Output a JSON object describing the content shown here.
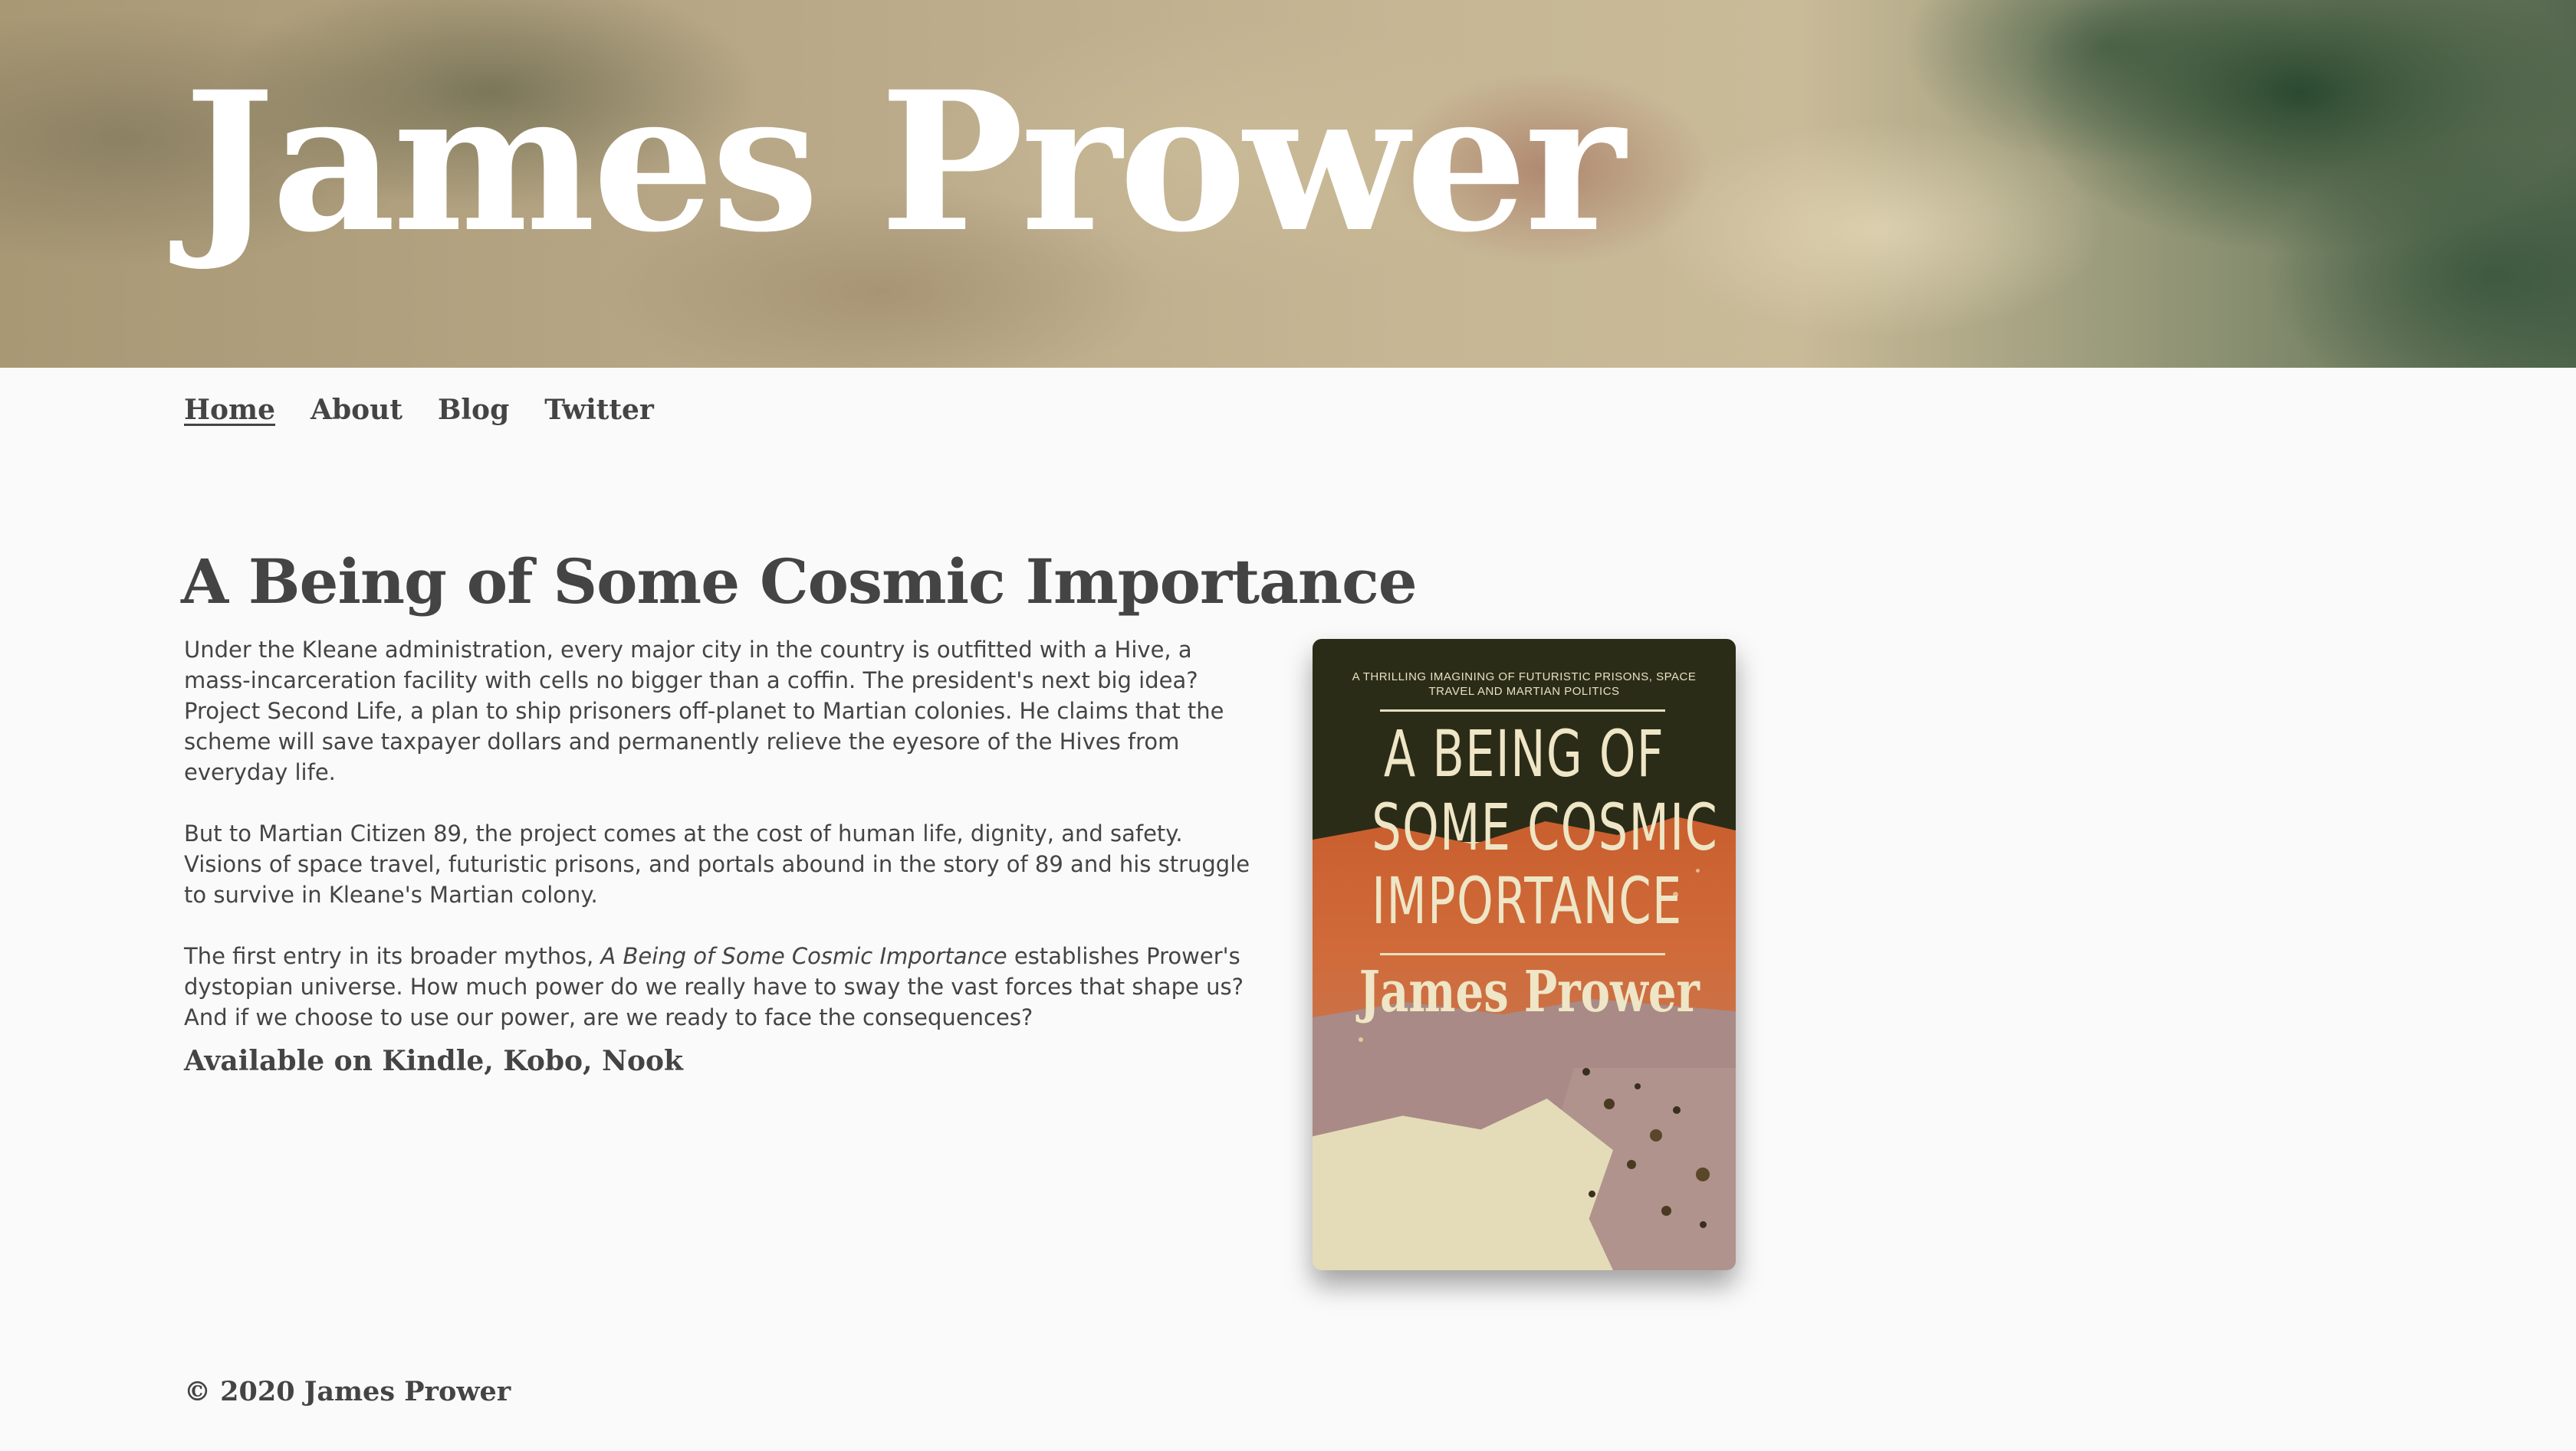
{
  "header": {
    "site_title": "James Prower"
  },
  "nav": {
    "items": [
      {
        "label": "Home",
        "active": true
      },
      {
        "label": "About",
        "active": false
      },
      {
        "label": "Blog",
        "active": false
      },
      {
        "label": "Twitter",
        "active": false
      }
    ]
  },
  "main": {
    "book_title": "A Being of Some Cosmic Importance",
    "paragraph_1": "Under the Kleane administration, every major city in the country is outfitted with a Hive, a mass-incarceration facility with cells no bigger than a coffin. The president's next big idea? Project Second Life, a plan to ship prisoners off-planet to Martian colonies. He claims that the scheme will save taxpayer dollars and permanently relieve the eyesore of the Hives from everyday life.",
    "paragraph_2": "But to Martian Citizen 89, the project comes at the cost of human life, dignity, and safety. Visions of space travel, futuristic prisons, and portals abound in the story of 89 and his struggle to survive in Kleane's Martian colony.",
    "paragraph_3_before": "The first entry in its broader mythos, ",
    "paragraph_3_emphasis": "A Being of Some Cosmic Importance",
    "paragraph_3_after": " establishes Prower's dystopian universe. How much power do we really have to sway the vast forces that shape us? And if we choose to use our power, are we ready to face the consequences?",
    "availability": "Available on Kindle, Kobo, Nook"
  },
  "cover": {
    "tagline": "A THRILLING IMAGINING OF FUTURISTIC PRISONS, SPACE TRAVEL AND MARTIAN POLITICS",
    "title_line_1": "A BEING OF",
    "title_line_2": "SOME COSMIC",
    "title_line_3": "IMPORTANCE",
    "author": "James Prower",
    "colors": {
      "dark": "#2b2c17",
      "orange": "#c95e2e",
      "mauve": "#a98a86",
      "cream": "#e4dcb8"
    }
  },
  "footer": {
    "copyright": "© 2020 James Prower"
  }
}
